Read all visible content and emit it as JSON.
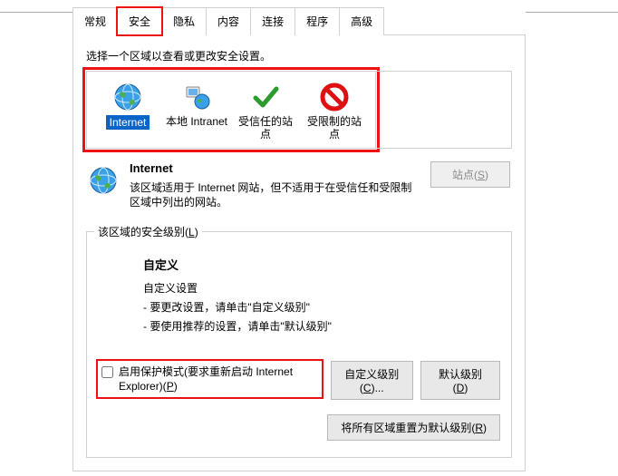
{
  "tabs": {
    "general": "常规",
    "security": "安全",
    "privacy": "隐私",
    "content": "内容",
    "connections": "连接",
    "programs": "程序",
    "advanced": "高级"
  },
  "prompt": "选择一个区域以查看或更改安全设置。",
  "zones": {
    "internet": "Internet",
    "intranet": "本地 Intranet",
    "trusted": "受信任的站点",
    "restricted": "受限制的站点"
  },
  "detail": {
    "title": "Internet",
    "desc": "该区域适用于 Internet 网站，但不适用于在受信任和受限制区域中列出的网站。",
    "sites_btn": "站点(S)"
  },
  "level": {
    "legend": "该区域的安全级别(L)",
    "title": "自定义",
    "sub": "自定义设置",
    "line1": "- 要更改设置，请单击\"自定义级别\"",
    "line2": "- 要使用推荐的设置，请单击\"默认级别\"",
    "protect": "启用保护模式(要求重新启动 Internet Explorer)(P)",
    "custom_btn": "自定义级别(C)...",
    "default_btn": "默认级别(D)",
    "reset_btn": "将所有区域重置为默认级别(R)"
  }
}
